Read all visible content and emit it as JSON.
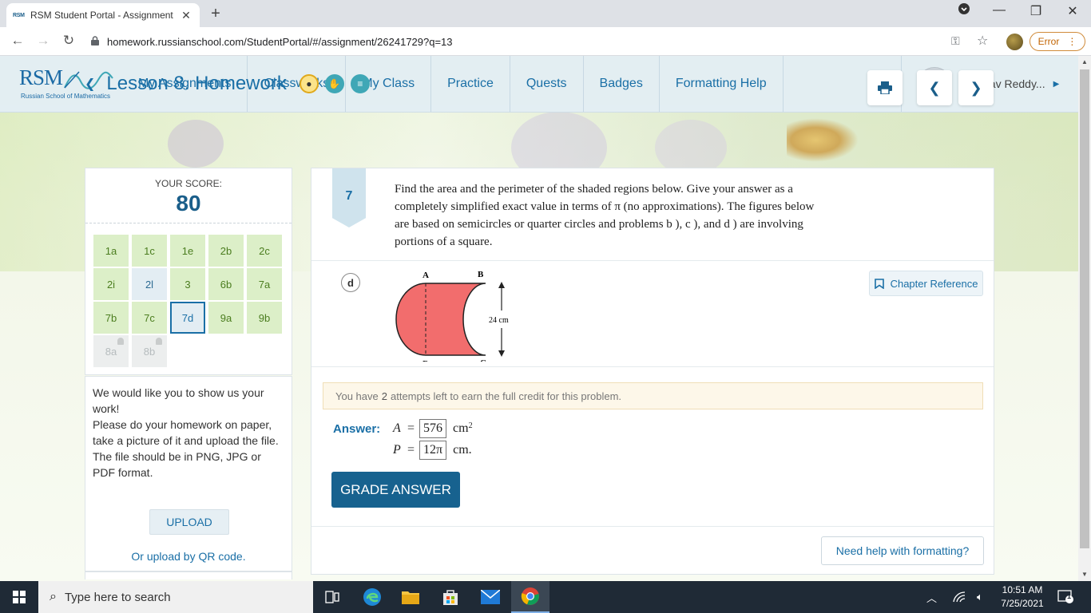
{
  "browser": {
    "tab_title": "RSM Student Portal - Assignment",
    "tab_favicon": "RSM",
    "url": "homework.russianschool.com/StudentPortal/#/assignment/26241729?q=13",
    "error_label": "Error"
  },
  "header": {
    "logo_text": "RSM",
    "logo_subtitle": "Russian School of Mathematics",
    "menu": [
      "My Assignments",
      "Classworks",
      "My Class",
      "Practice",
      "Quests",
      "Badges",
      "Formatting Help"
    ],
    "user_name": "Abhinav Reddy..."
  },
  "lesson": {
    "title": "Lesson 8. Homework"
  },
  "score": {
    "label": "YOUR SCORE:",
    "value": "80",
    "problems": [
      {
        "id": "1a",
        "state": "correct"
      },
      {
        "id": "1c",
        "state": "correct"
      },
      {
        "id": "1e",
        "state": "correct"
      },
      {
        "id": "2b",
        "state": "correct"
      },
      {
        "id": "2c",
        "state": "correct"
      },
      {
        "id": "2i",
        "state": "correct"
      },
      {
        "id": "2l",
        "state": "pending"
      },
      {
        "id": "3",
        "state": "correct"
      },
      {
        "id": "6b",
        "state": "correct"
      },
      {
        "id": "7a",
        "state": "correct"
      },
      {
        "id": "7b",
        "state": "correct"
      },
      {
        "id": "7c",
        "state": "correct"
      },
      {
        "id": "7d",
        "state": "selected"
      },
      {
        "id": "9a",
        "state": "correct"
      },
      {
        "id": "9b",
        "state": "correct"
      },
      {
        "id": "8a",
        "state": "locked"
      },
      {
        "id": "8b",
        "state": "locked"
      }
    ]
  },
  "upload": {
    "line1": "We would like you to show us your work!",
    "line2": "Please do your homework on paper, take a picture of it and upload the file.",
    "line3": "The file should be in PNG, JPG or PDF format.",
    "button": "UPLOAD",
    "qr_link": "Or upload by QR code."
  },
  "problem": {
    "number": "7",
    "text": "Find the area and the perimeter of the shaded regions below. Give your answer as a completely simplified exact value in terms of π (no approximations). The figures below are based on semicircles or quarter circles and problems b ), c ), and d ) are involving portions of a square.",
    "part": "d",
    "chapter_reference": "Chapter Reference",
    "figure": {
      "labels": [
        "A",
        "B",
        "C",
        "D"
      ],
      "dimension": "24 cm"
    },
    "attempts_prefix": "You have",
    "attempts": "2",
    "attempts_suffix": "attempts left to earn the full credit for this problem.",
    "answer_label": "Answer:",
    "area_var": "A",
    "area_value": "576",
    "area_unit": "cm",
    "area_exp": "2",
    "perimeter_var": "P",
    "perimeter_value": "12π",
    "perimeter_unit": "cm.",
    "grade_button": "GRADE ANSWER",
    "help_button": "Need help with formatting?"
  },
  "taskbar": {
    "search_placeholder": "Type here to search",
    "time": "10:51 AM",
    "date": "7/25/2021",
    "notifications": "1"
  },
  "colors": {
    "brand": "#1a6fa6",
    "correct_cell": "#dcefc8",
    "grade_button": "#17628f",
    "shaded_region": "#f26d6d"
  }
}
